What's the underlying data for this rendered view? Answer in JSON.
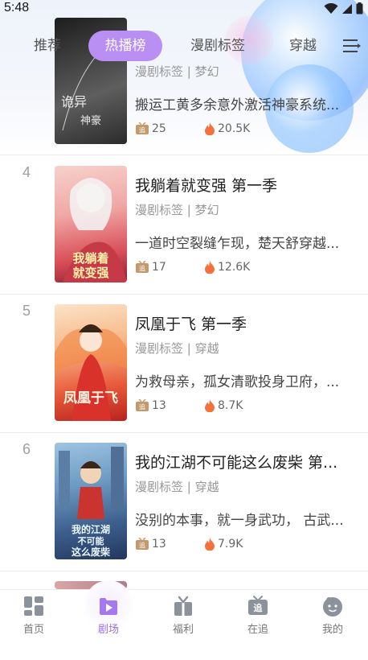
{
  "status_bar": {
    "time": "5:48"
  },
  "tabs": [
    {
      "label": "推荐",
      "active": false
    },
    {
      "label": "热播榜",
      "active": true
    },
    {
      "label": "漫剧标签",
      "active": false
    },
    {
      "label": "穿越",
      "active": false
    }
  ],
  "list": [
    {
      "rank": "",
      "title": "",
      "tags": "漫剧标签 | 梦幻",
      "desc": "搬运工黄多余意外激活神豪系统...",
      "follows": "25",
      "heat": "20.5K",
      "cover_text": "诡异…神豪",
      "cover_colors": [
        "#2a2a2a",
        "#7a7a7a"
      ]
    },
    {
      "rank": "4",
      "title": "我躺着就变强 第一季",
      "tags": "漫剧标签 | 梦幻",
      "desc": "一道时空裂缝乍现，楚天舒穿越...",
      "follows": "17",
      "heat": "12.6K",
      "cover_text": "我躺着就变强",
      "cover_colors": [
        "#f3b6b0",
        "#c9484f"
      ]
    },
    {
      "rank": "5",
      "title": "凤凰于飞 第一季",
      "tags": "漫剧标签 | 穿越",
      "desc": "为救母亲，孤女清歌投身卫府，...",
      "follows": "13",
      "heat": "8.7K",
      "cover_text": "凤凰于飞",
      "cover_colors": [
        "#f7c49a",
        "#d9342b"
      ]
    },
    {
      "rank": "6",
      "title": "我的江湖不可能这么废柴 第...",
      "tags": "漫剧标签 | 穿越",
      "desc": "没别的本事，就一身武功， 古武...",
      "follows": "13",
      "heat": "7.9K",
      "cover_text": "我的江湖不可能这么废柴",
      "cover_colors": [
        "#7fa8c9",
        "#2f4e7a"
      ]
    }
  ],
  "bottom_nav": [
    {
      "label": "首页",
      "icon": "home-grid-icon",
      "active": false
    },
    {
      "label": "剧场",
      "icon": "play-icon",
      "active": true
    },
    {
      "label": "福利",
      "icon": "gift-icon",
      "active": false
    },
    {
      "label": "在追",
      "icon": "tv-follow-icon",
      "active": false
    },
    {
      "label": "我的",
      "icon": "profile-face-icon",
      "active": false
    }
  ],
  "colors": {
    "accent": "#b98ff3",
    "accent_text": "#9a6ee8",
    "heat": "#f2713c",
    "follow_badge": "#c49a6c"
  }
}
